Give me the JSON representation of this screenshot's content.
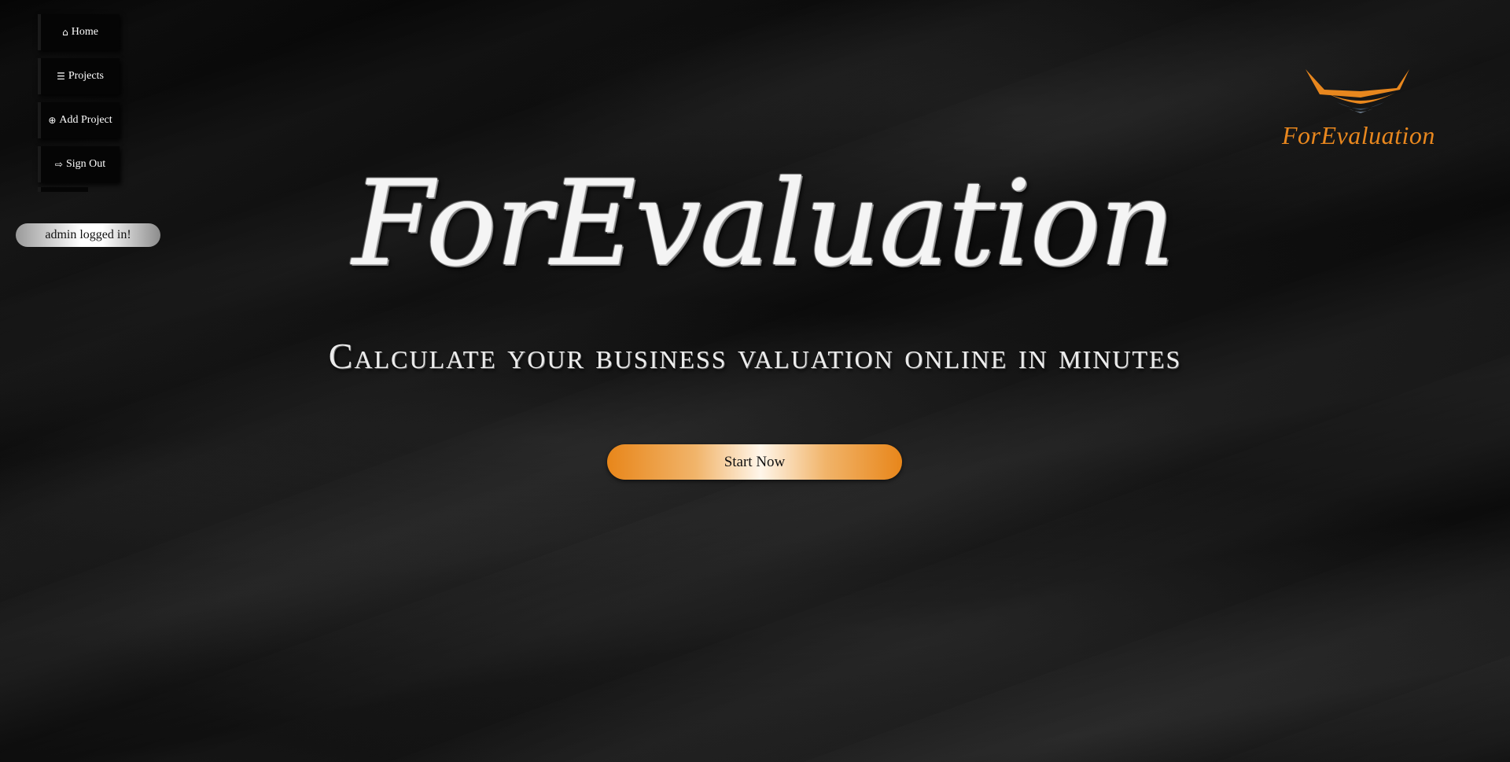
{
  "nav": {
    "items": [
      {
        "icon": "home-icon",
        "glyph": "⌂",
        "label": "Home"
      },
      {
        "icon": "list-icon",
        "glyph": "☰",
        "label": "Projects"
      },
      {
        "icon": "plus-circle-icon",
        "glyph": "⊕",
        "label": "Add Project"
      },
      {
        "icon": "sign-out-icon",
        "glyph": "⇨",
        "label": "Sign Out"
      }
    ]
  },
  "status": {
    "logged_in": "admin logged in!"
  },
  "logo": {
    "text": "ForEvaluation",
    "accent": "#e8871e"
  },
  "hero": {
    "title": "ForEvaluation",
    "subtitle": "Calculate your business valuation online in minutes",
    "cta_label": "Start Now"
  }
}
